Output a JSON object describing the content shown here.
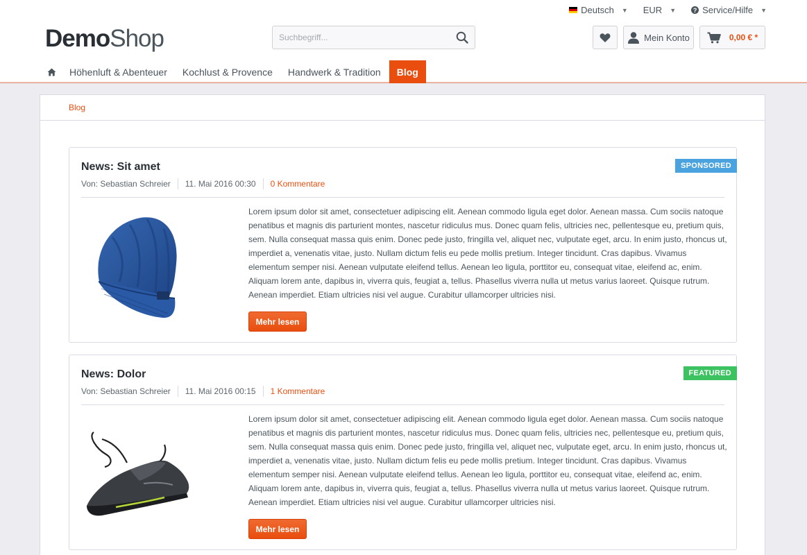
{
  "top_links": {
    "language": "Deutsch",
    "currency": "EUR",
    "service": "Service/Hilfe"
  },
  "logo": {
    "bold": "Demo",
    "light": "Shop"
  },
  "search": {
    "placeholder": "Suchbegriff..."
  },
  "actions": {
    "account": "Mein Konto",
    "cart_total": "0,00 € *"
  },
  "nav": {
    "items": [
      "Höhenluft & Abenteuer",
      "Kochlust & Provence",
      "Handwerk & Tradition",
      "Blog"
    ],
    "active": "Blog"
  },
  "breadcrumb": "Blog",
  "posts": [
    {
      "title": "News: Sit amet",
      "author": "Von: Sebastian Schreier",
      "date": "11. Mai 2016 00:30",
      "comments": "0 Kommentare",
      "badge": "SPONSORED",
      "image": "beanie-hat-image",
      "text": "Lorem ipsum dolor sit amet, consectetuer adipiscing elit. Aenean commodo ligula eget dolor. Aenean massa. Cum sociis natoque penatibus et magnis dis parturient montes, nascetur ridiculus mus. Donec quam felis, ultricies nec, pellentesque eu, pretium quis, sem. Nulla consequat massa quis enim. Donec pede justo, fringilla vel, aliquet nec, vulputate eget, arcu. In enim justo, rhoncus ut, imperdiet a, venenatis vitae, justo. Nullam dictum felis eu pede mollis pretium. Integer tincidunt. Cras dapibus. Vivamus elementum semper nisi. Aenean vulputate eleifend tellus. Aenean leo ligula, porttitor eu, consequat vitae, eleifend ac, enim. Aliquam lorem ante, dapibus in, viverra quis, feugiat a, tellus. Phasellus viverra nulla ut metus varius laoreet. Quisque rutrum. Aenean imperdiet. Etiam ultricies nisi vel augue. Curabitur ullamcorper ultricies nisi.",
      "button": "Mehr lesen"
    },
    {
      "title": "News: Dolor",
      "author": "Von: Sebastian Schreier",
      "date": "11. Mai 2016 00:15",
      "comments": "1 Kommentare",
      "badge": "FEATURED",
      "image": "sneaker-shoe-image",
      "text": "Lorem ipsum dolor sit amet, consectetuer adipiscing elit. Aenean commodo ligula eget dolor. Aenean massa. Cum sociis natoque penatibus et magnis dis parturient montes, nascetur ridiculus mus. Donec quam felis, ultricies nec, pellentesque eu, pretium quis, sem. Nulla consequat massa quis enim. Donec pede justo, fringilla vel, aliquet nec, vulputate eget, arcu. In enim justo, rhoncus ut, imperdiet a, venenatis vitae, justo. Nullam dictum felis eu pede mollis pretium. Integer tincidunt. Cras dapibus. Vivamus elementum semper nisi. Aenean vulputate eleifend tellus. Aenean leo ligula, porttitor eu, consequat vitae, eleifend ac, enim. Aliquam lorem ante, dapibus in, viverra quis, feugiat a, tellus. Phasellus viverra nulla ut metus varius laoreet. Quisque rutrum. Aenean imperdiet. Etiam ultricies nisi vel augue. Curabitur ullamcorper ultricies nisi.",
      "button": "Mehr lesen"
    }
  ],
  "colors": {
    "accent": "#e94e0f",
    "sponsored": "#4aa3df",
    "featured": "#3cc261",
    "background": "#ececf1"
  }
}
